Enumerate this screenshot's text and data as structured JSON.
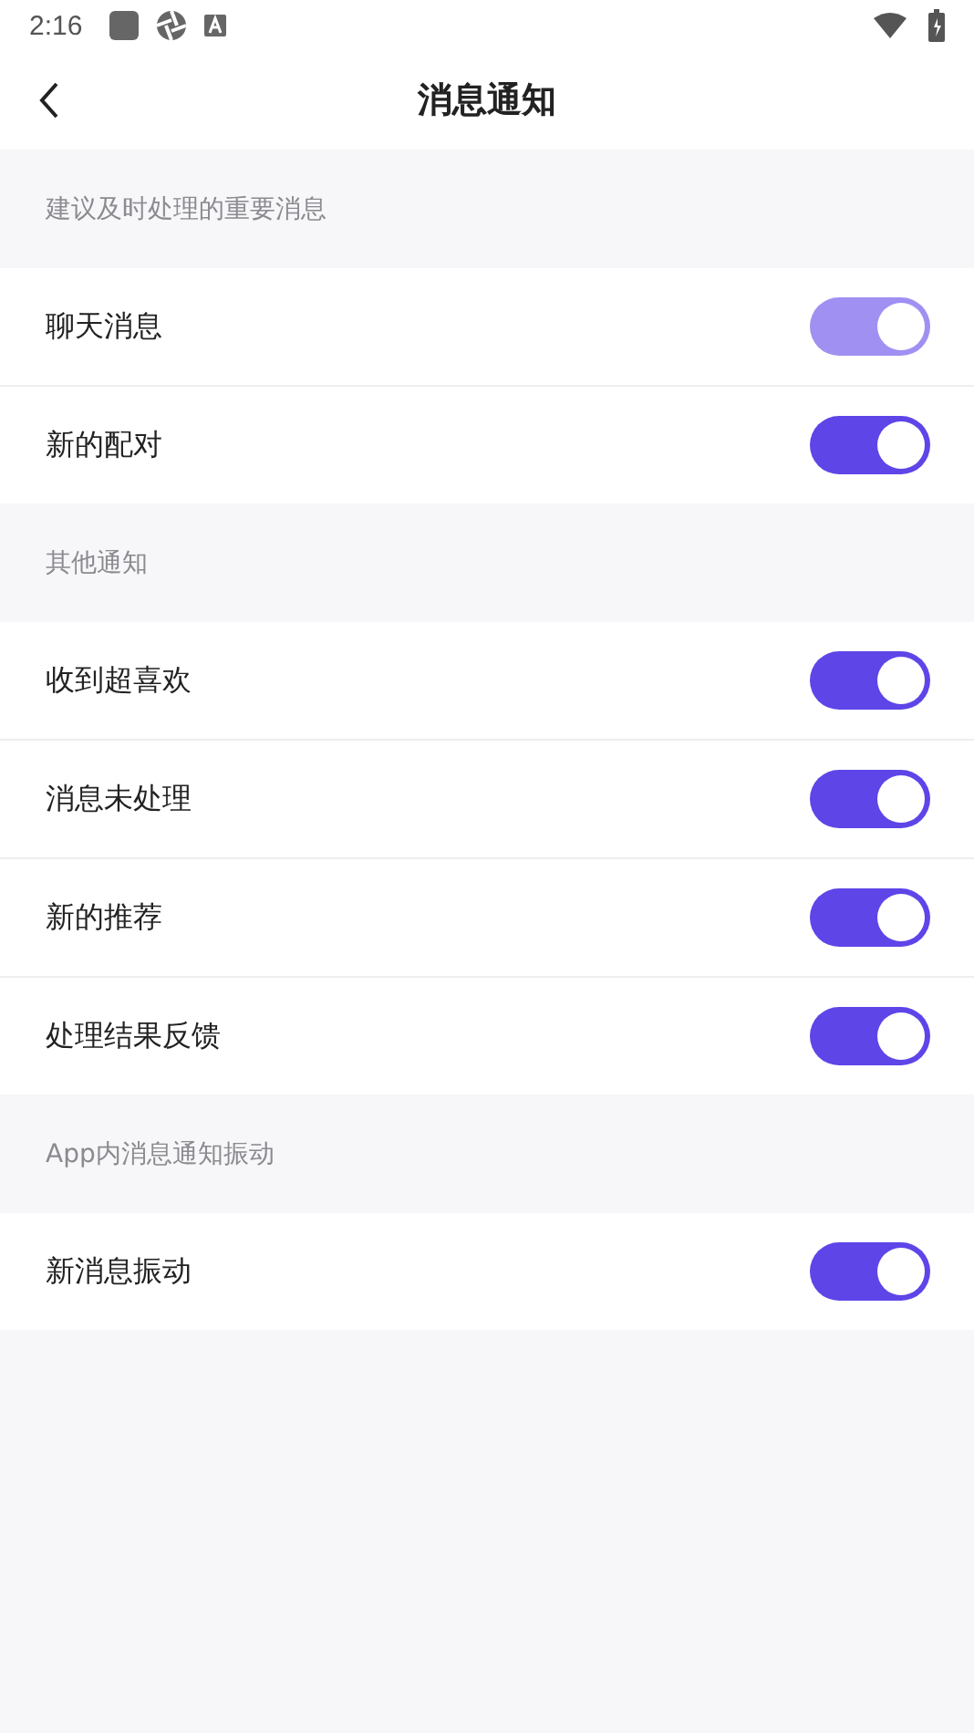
{
  "status_bar": {
    "time": "2:16"
  },
  "header": {
    "title": "消息通知"
  },
  "sections": [
    {
      "title": "建议及时处理的重要消息",
      "items": [
        {
          "label": "聊天消息",
          "on": true,
          "disabled": true
        },
        {
          "label": "新的配对",
          "on": true,
          "disabled": false
        }
      ]
    },
    {
      "title": "其他通知",
      "items": [
        {
          "label": "收到超喜欢",
          "on": true,
          "disabled": false
        },
        {
          "label": "消息未处理",
          "on": true,
          "disabled": false
        },
        {
          "label": "新的推荐",
          "on": true,
          "disabled": false
        },
        {
          "label": "处理结果反馈",
          "on": true,
          "disabled": false
        }
      ]
    },
    {
      "title": "App内消息通知振动",
      "items": [
        {
          "label": "新消息振动",
          "on": true,
          "disabled": false
        }
      ]
    }
  ]
}
